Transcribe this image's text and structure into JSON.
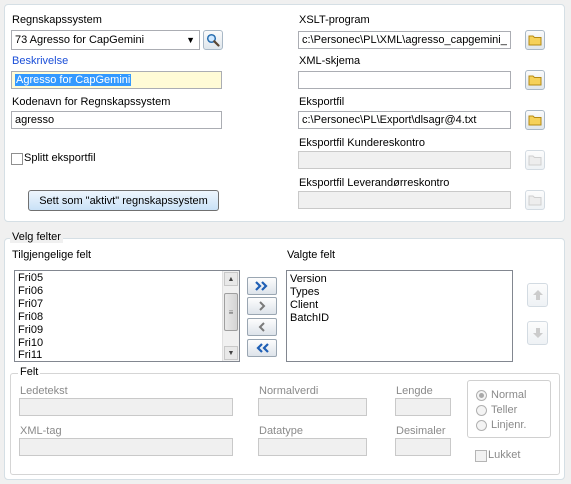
{
  "system": {
    "regnskapssystem_label": "Regnskapssystem",
    "regnskapssystem_value": "73 Agresso for CapGemini",
    "beskrivelse_label": "Beskrivelse",
    "beskrivelse_value": "Agresso for CapGemini",
    "kodenavn_label": "Kodenavn for Regnskapssystem",
    "kodenavn_value": "agresso",
    "splitt_label": "Splitt eksportfil",
    "aktivt_button": "Sett som \"aktivt\" regnskapssystem",
    "xslt_label": "XSLT-program",
    "xslt_value": "c:\\Personec\\PL\\XML\\agresso_capgemini_",
    "xml_skjema_label": "XML-skjema",
    "xml_skjema_value": "",
    "eksportfil_label": "Eksportfil",
    "eksportfil_value": "c:\\Personec\\PL\\Export\\dlsagr@4.txt",
    "kundereskontro_label": "Eksportfil Kundereskontro",
    "kundereskontro_value": "",
    "leverandor_label": "Eksportfil Leverandørreskontro",
    "leverandor_value": ""
  },
  "felter": {
    "group_label": "Velg felter",
    "tilgjengelige_label": "Tilgjengelige felt",
    "tilgjengelige_items": [
      "Fri05",
      "Fri06",
      "Fri07",
      "Fri08",
      "Fri09",
      "Fri10",
      "Fri11"
    ],
    "valgte_label": "Valgte felt",
    "valgte_items": [
      "Version",
      "Types",
      "Client",
      "BatchID"
    ]
  },
  "felt": {
    "group_label": "Felt",
    "ledetekst_label": "Ledetekst",
    "normalverdi_label": "Normalverdi",
    "lengde_label": "Lengde",
    "xml_tag_label": "XML-tag",
    "datatype_label": "Datatype",
    "desimaler_label": "Desimaler",
    "radio_normal": "Normal",
    "radio_teller": "Teller",
    "radio_linjenr": "Linjenr.",
    "lukket_label": "Lukket"
  },
  "icons": {
    "search": "magnifier-icon",
    "folder": "folder-icon",
    "move_all_right": "double-chevron-right-icon",
    "move_right": "chevron-right-icon",
    "move_left": "chevron-left-icon",
    "move_all_left": "double-chevron-left-icon",
    "move_up": "arrow-up-icon",
    "move_down": "arrow-down-icon"
  }
}
